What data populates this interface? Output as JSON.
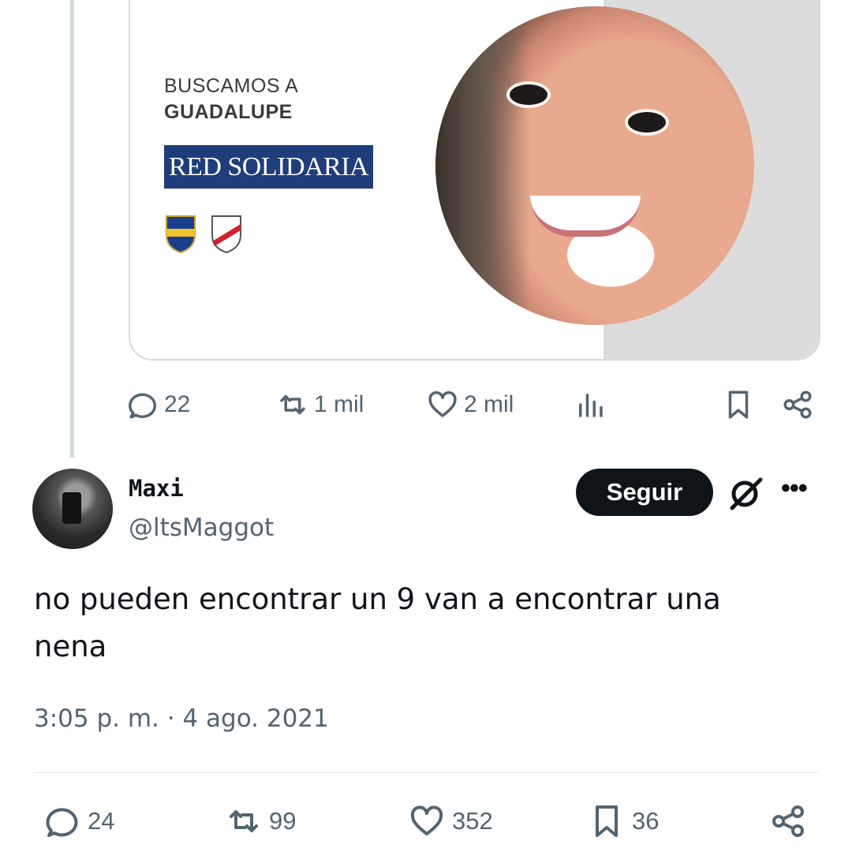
{
  "quoted_card": {
    "line1": "BUSCAMOS A",
    "line2": "GUADALUPE",
    "brand": "RED SOLIDARIA"
  },
  "quoted_actions": {
    "replies": "22",
    "retweets": "1 mil",
    "likes": "2 mil"
  },
  "reply": {
    "name": "Maxi",
    "handle": "@ltsMaggot",
    "follow_label": "Seguir",
    "text": "no pueden encontrar un 9 van a encontrar una nena",
    "timestamp": "3:05 p. m. · 4 ago. 2021"
  },
  "reply_actions": {
    "replies": "24",
    "retweets": "99",
    "likes": "352",
    "bookmarks": "36"
  },
  "icons": [
    "reply-icon",
    "retweet-icon",
    "like-icon",
    "views-icon",
    "bookmark-icon",
    "share-icon",
    "grok-icon",
    "more-icon"
  ],
  "colors": {
    "text": "#0f1419",
    "muted": "#536471",
    "brand_blue": "#1f3d7a"
  }
}
